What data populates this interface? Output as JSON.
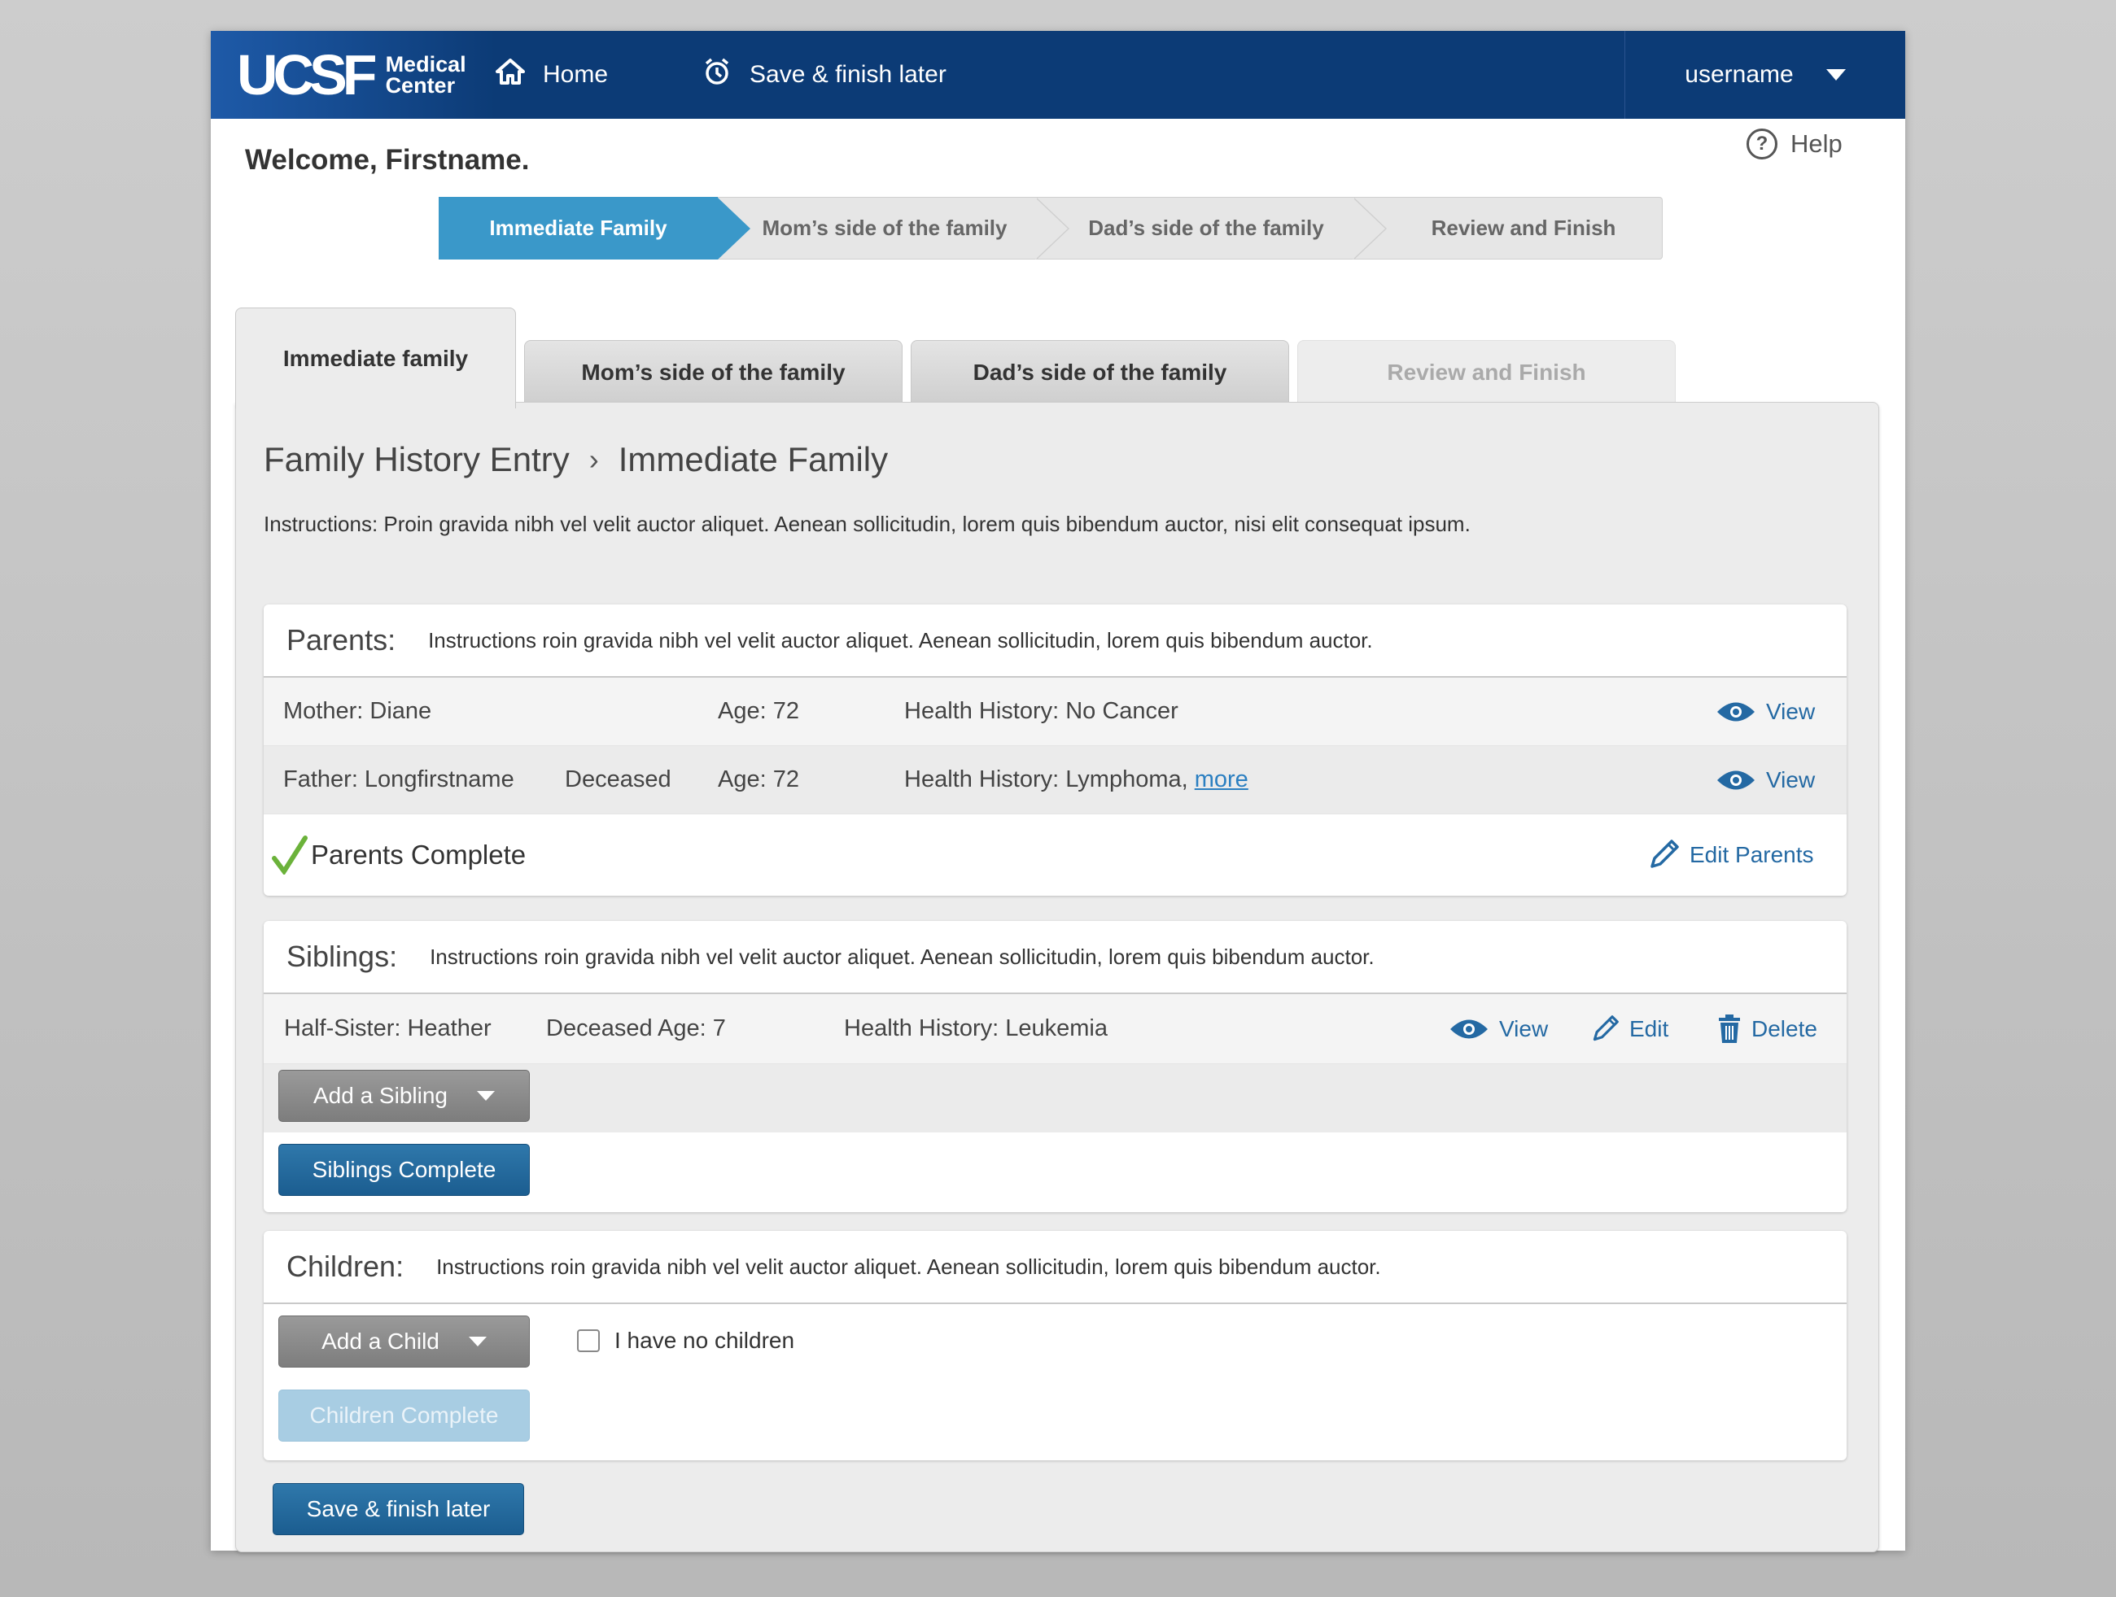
{
  "header": {
    "logo_main": "UCSF",
    "logo_sub_1": "Medical",
    "logo_sub_2": "Center",
    "home_label": "Home",
    "save_later_label": "Save & finish later",
    "username": "username"
  },
  "welcome": "Welcome, Firstname.",
  "help_label": "Help",
  "steps": [
    {
      "label": "Immediate Family",
      "active": true
    },
    {
      "label": "Mom’s side of the family",
      "active": false
    },
    {
      "label": "Dad’s side of the family",
      "active": false
    },
    {
      "label": "Review and Finish",
      "active": false
    }
  ],
  "tabs": [
    {
      "label": "Immediate family",
      "state": "active"
    },
    {
      "label": "Mom’s side of the family",
      "state": "inactive"
    },
    {
      "label": "Dad’s side of the family",
      "state": "inactive"
    },
    {
      "label": "Review and Finish",
      "state": "disabled"
    }
  ],
  "breadcrumb": {
    "root": "Family History Entry",
    "separator": "›",
    "current": "Immediate Family"
  },
  "instructions": "Instructions: Proin gravida nibh vel velit auctor aliquet. Aenean sollicitudin, lorem quis bibendum auctor, nisi elit consequat ipsum.",
  "parents": {
    "title": "Parents:",
    "instructions": "Instructions roin gravida nibh vel velit auctor aliquet. Aenean sollicitudin, lorem quis bibendum auctor.",
    "rows": [
      {
        "name": "Mother: Diane",
        "status": "",
        "age": "Age: 72",
        "health": "Health History: No Cancer",
        "more": "",
        "view": "View"
      },
      {
        "name": "Father: Longfirstname",
        "status": "Deceased",
        "age": "Age: 72",
        "health": "Health History: Lymphoma,",
        "more": "more",
        "view": "View"
      }
    ],
    "complete_label": "Parents Complete",
    "edit_label": "Edit Parents"
  },
  "siblings": {
    "title": "Siblings:",
    "instructions": "Instructions roin gravida nibh vel velit auctor aliquet. Aenean sollicitudin, lorem quis bibendum auctor.",
    "rows": [
      {
        "name": "Half-Sister: Heather",
        "status_age": "Deceased Age: 7",
        "health": "Health History: Leukemia",
        "view": "View",
        "edit": "Edit",
        "delete": "Delete"
      }
    ],
    "add_label": "Add a Sibling",
    "complete_label": "Siblings Complete"
  },
  "children": {
    "title": "Children:",
    "instructions": "Instructions roin gravida nibh vel velit auctor aliquet. Aenean sollicitudin, lorem quis bibendum auctor.",
    "add_label": "Add a Child",
    "no_children_label": "I have no children",
    "complete_label": "Children Complete"
  },
  "footer": {
    "save_later_label": "Save & finish later"
  },
  "colors": {
    "nav": "#0c3b76",
    "accent": "#3a98c9",
    "button_blue": "#1b5d90",
    "link": "#2469a3",
    "check": "#6bb23a"
  }
}
